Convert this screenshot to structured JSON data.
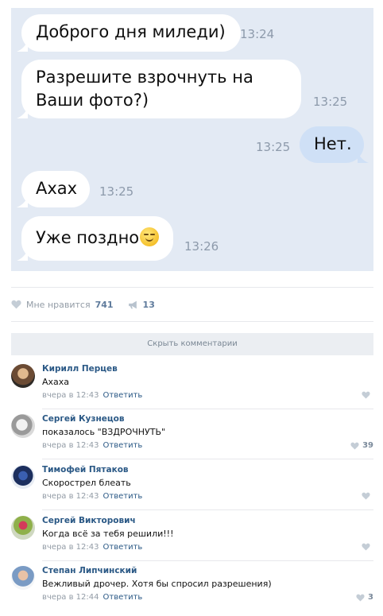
{
  "chat": {
    "messages": [
      {
        "text": "Доброго дня миледи)",
        "time": "13:24",
        "dir": "in"
      },
      {
        "line1": "Разрешите взрочнуть на",
        "line2": "Ваши фото?)",
        "time": "13:25",
        "dir": "in"
      },
      {
        "text": "Нет.",
        "time": "13:25",
        "dir": "out"
      },
      {
        "text": "Axax",
        "time": "13:25",
        "dir": "in"
      },
      {
        "text": "Уже поздно",
        "emoji": "smirk-emoji-icon",
        "time": "13:26",
        "dir": "in"
      }
    ],
    "colors": {
      "background": "#e3eaf4",
      "incoming": "#ffffff",
      "outgoing": "#cfe0f6"
    }
  },
  "post": {
    "like_label": "Мне нравится",
    "like_count": "741",
    "share_count": "13",
    "hide_comments": "Скрыть комментарии"
  },
  "comments": [
    {
      "author": "Кирилл Перцев",
      "text": "Axaxa",
      "date": "вчера в 12:43",
      "reply": "Ответить",
      "likes": ""
    },
    {
      "author": "Сергей Кузнецов",
      "text": "показалось \"ВЗДРОЧНУТЬ\"",
      "date": "вчера в 12:43",
      "reply": "Ответить",
      "likes": "39"
    },
    {
      "author": "Тимофей Пятаков",
      "text": "Скорострел блеать",
      "date": "вчера в 12:43",
      "reply": "Ответить",
      "likes": ""
    },
    {
      "author": "Сергей Викторович",
      "text": "Когда всё за тебя решили!!!",
      "date": "вчера в 12:43",
      "reply": "Ответить",
      "likes": ""
    },
    {
      "author": "Степан Липчинский",
      "text": "Вежливый дрочер. Хотя бы спросил разрешения)",
      "date": "вчера в 12:44",
      "reply": "Ответить",
      "likes": "3"
    }
  ],
  "colors": {
    "link": "#2a5885",
    "muted": "#939ca6",
    "divider": "#e7e8ec"
  }
}
